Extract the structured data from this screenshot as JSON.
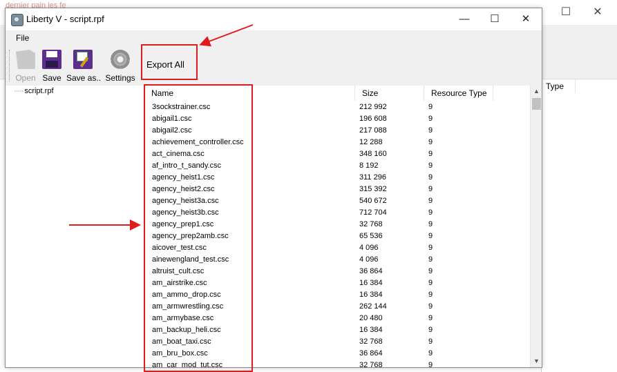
{
  "background_window": {
    "watermark": "dernier pain les fe",
    "controls": {
      "minimize": "—",
      "maximize": "☐",
      "close": "✕"
    },
    "column_header": "Type"
  },
  "window": {
    "title": "Liberty V - script.rpf",
    "controls": {
      "minimize": "—",
      "maximize": "☐",
      "close": "✕"
    }
  },
  "menu": {
    "file": "File"
  },
  "toolbar": {
    "open": "Open",
    "save": "Save",
    "save_as": "Save as..",
    "settings": "Settings",
    "export_all": "Export All"
  },
  "tree": {
    "items": [
      {
        "label": "script.rpf"
      }
    ]
  },
  "list": {
    "columns": [
      "Name",
      "Size",
      "Resource Type"
    ],
    "rows": [
      {
        "name": "3sockstrainer.csc",
        "size": "212 992",
        "type": "9"
      },
      {
        "name": "abigail1.csc",
        "size": "196 608",
        "type": "9"
      },
      {
        "name": "abigail2.csc",
        "size": "217 088",
        "type": "9"
      },
      {
        "name": "achievement_controller.csc",
        "size": "12 288",
        "type": "9"
      },
      {
        "name": "act_cinema.csc",
        "size": "348 160",
        "type": "9"
      },
      {
        "name": "af_intro_t_sandy.csc",
        "size": "8 192",
        "type": "9"
      },
      {
        "name": "agency_heist1.csc",
        "size": "311 296",
        "type": "9"
      },
      {
        "name": "agency_heist2.csc",
        "size": "315 392",
        "type": "9"
      },
      {
        "name": "agency_heist3a.csc",
        "size": "540 672",
        "type": "9"
      },
      {
        "name": "agency_heist3b.csc",
        "size": "712 704",
        "type": "9"
      },
      {
        "name": "agency_prep1.csc",
        "size": "32 768",
        "type": "9"
      },
      {
        "name": "agency_prep2amb.csc",
        "size": "65 536",
        "type": "9"
      },
      {
        "name": "aicover_test.csc",
        "size": "4 096",
        "type": "9"
      },
      {
        "name": "ainewengland_test.csc",
        "size": "4 096",
        "type": "9"
      },
      {
        "name": "altruist_cult.csc",
        "size": "36 864",
        "type": "9"
      },
      {
        "name": "am_airstrike.csc",
        "size": "16 384",
        "type": "9"
      },
      {
        "name": "am_ammo_drop.csc",
        "size": "16 384",
        "type": "9"
      },
      {
        "name": "am_armwrestling.csc",
        "size": "262 144",
        "type": "9"
      },
      {
        "name": "am_armybase.csc",
        "size": "20 480",
        "type": "9"
      },
      {
        "name": "am_backup_heli.csc",
        "size": "16 384",
        "type": "9"
      },
      {
        "name": "am_boat_taxi.csc",
        "size": "32 768",
        "type": "9"
      },
      {
        "name": "am_bru_box.csc",
        "size": "36 864",
        "type": "9"
      },
      {
        "name": "am_car_mod_tut.csc",
        "size": "32 768",
        "type": "9"
      }
    ]
  },
  "colors": {
    "annotation": "#e01b1b",
    "toolbar_bg": "#f0f0f0",
    "icon_purple": "#5b2e8f"
  }
}
